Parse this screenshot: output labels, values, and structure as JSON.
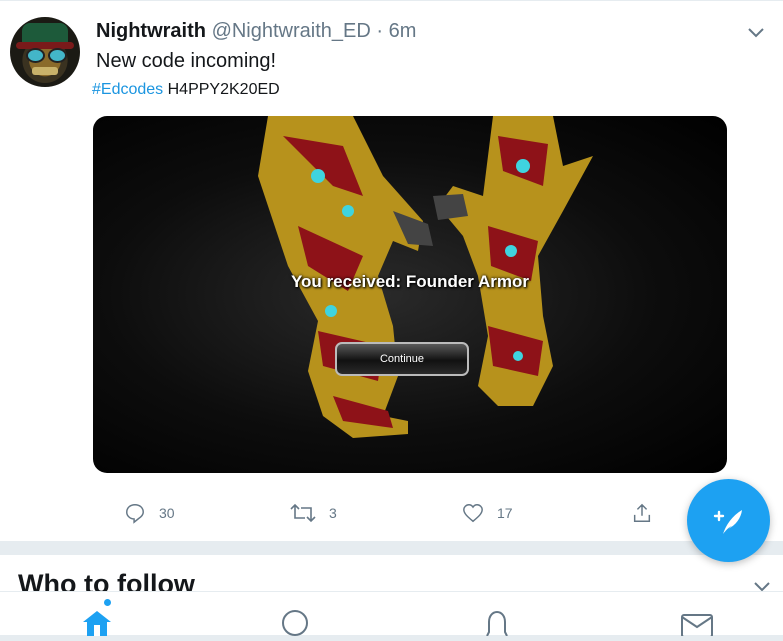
{
  "tweet": {
    "author_name": "Nightwraith",
    "author_handle": "@Nightwraith_ED",
    "separator": "·",
    "time": "6m",
    "text": "New code incoming!",
    "hashtag": "#Edcodes",
    "code": "H4PPY2K20ED",
    "media": {
      "received_text": "You received: Founder Armor",
      "continue_label": "Continue"
    },
    "actions": {
      "replies": "30",
      "retweets": "3",
      "likes": "17"
    }
  },
  "who_to_follow": {
    "title": "Who to follow"
  },
  "icons": {
    "reply": "reply-icon",
    "retweet": "retweet-icon",
    "like": "like-icon",
    "share": "share-icon",
    "compose": "compose-tweet-icon",
    "home": "home-icon",
    "search": "search-icon",
    "notifications": "notifications-icon",
    "messages": "messages-icon"
  },
  "colors": {
    "accent": "#1da1f2",
    "link": "#1b95e0",
    "muted": "#657786"
  }
}
